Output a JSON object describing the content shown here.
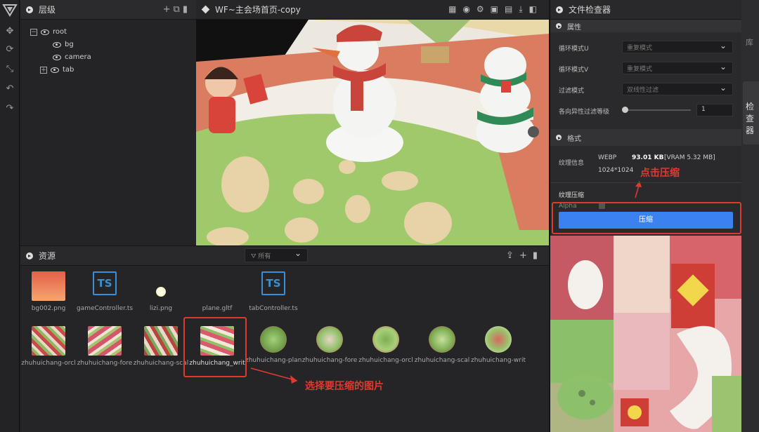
{
  "hierarchy": {
    "title": "层级",
    "items": [
      "root",
      "bg",
      "camera",
      "tab"
    ]
  },
  "scene": {
    "title": "WF~主会场首页-copy"
  },
  "assets": {
    "title": "资源",
    "filter": "所有",
    "row1": [
      "bg002.png",
      "gameController.ts",
      "lizi.png",
      "plane.gltf",
      "tabController.ts"
    ],
    "ts_badge": "TS",
    "row2": [
      "zhuhuichang-orcl",
      "zhuhuichang-fore",
      "zhuhuichang-scal",
      "zhuhuichang_writ",
      "zhuhuichang-plan",
      "zhuhuichang-fore",
      "zhuhuichang-orcl",
      "zhuhuichang-scal",
      "zhuhuichang-writ"
    ]
  },
  "inspector": {
    "title": "文件检查器",
    "attr_section": "属性",
    "wrap_u_label": "循环模式U",
    "wrap_u_value": "重复模式",
    "wrap_v_label": "循环模式V",
    "wrap_v_value": "重复模式",
    "filter_label": "过滤模式",
    "filter_value": "双线性过滤",
    "aniso_label": "各向异性过滤等级",
    "aniso_value": "1",
    "format_section": "格式",
    "tex_info_label": "纹理信息",
    "tex_format": "WEBP",
    "tex_size": "93.01 KB",
    "tex_vram": "[VRAM 5.32 MB]",
    "tex_dim": "1024*1024",
    "compress_section": "纹理压缩",
    "alpha_label": "Alpha",
    "compress_button": "压缩"
  },
  "sidebar": {
    "lib": "库",
    "inspector": "检查器"
  },
  "annotations": {
    "click": "点击压缩",
    "select": "选择要压缩的图片"
  }
}
